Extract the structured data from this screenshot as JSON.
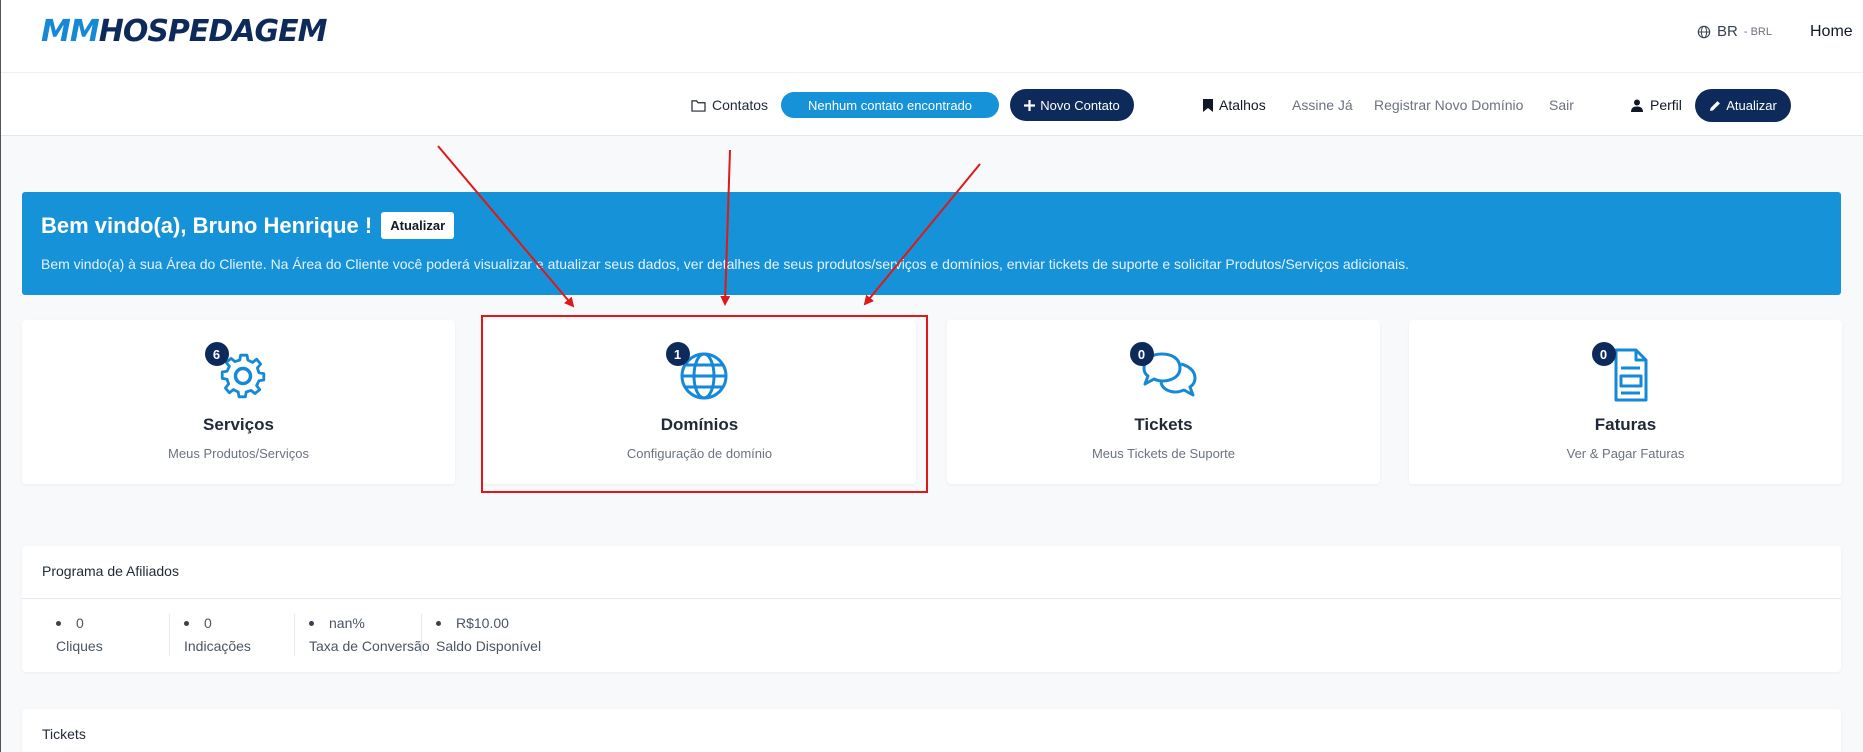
{
  "header": {
    "logo_mm": "MM",
    "logo_rest": "HOSPEDAGEM",
    "lang": "BR",
    "currency": "- BRL",
    "home": "Home"
  },
  "subnav": {
    "contacts": "Contatos",
    "no_contact": "Nenhum contato encontrado",
    "new_contact": "Novo Contato",
    "shortcuts": "Atalhos",
    "subscribe": "Assine Já",
    "register_domain": "Registrar Novo Domínio",
    "logout": "Sair",
    "profile": "Perfil",
    "update": "Atualizar"
  },
  "banner": {
    "title": "Bem vindo(a), Bruno Henrique !",
    "update_button": "Atualizar",
    "text": "Bem vindo(a) à sua Área do Cliente. Na Área do Cliente você poderá visualizar e atualizar seus dados, ver detalhes de seus produtos/serviços e domínios, enviar tickets de suporte e solicitar Produtos/Serviços adicionais."
  },
  "tiles": [
    {
      "count": "6",
      "title": "Serviços",
      "subtitle": "Meus Produtos/Serviços",
      "icon": "gear-icon"
    },
    {
      "count": "1",
      "title": "Domínios",
      "subtitle": "Configuração de domínio",
      "icon": "globe-icon"
    },
    {
      "count": "0",
      "title": "Tickets",
      "subtitle": "Meus Tickets de Suporte",
      "icon": "chat-bubbles-icon"
    },
    {
      "count": "0",
      "title": "Faturas",
      "subtitle": "Ver & Pagar Faturas",
      "icon": "invoice-icon"
    }
  ],
  "affiliates": {
    "title": "Programa de Afiliados",
    "stats": [
      {
        "value": "0",
        "label": "Cliques"
      },
      {
        "value": "0",
        "label": "Indicações"
      },
      {
        "value": "nan%",
        "label": "Taxa de Conversão"
      },
      {
        "value": "R$10.00",
        "label": "Saldo Disponível"
      }
    ]
  },
  "tickets": {
    "title": "Tickets"
  },
  "colors": {
    "primary": "#1592d8",
    "navy": "#0d2a5a",
    "annotation": "#e01818"
  }
}
